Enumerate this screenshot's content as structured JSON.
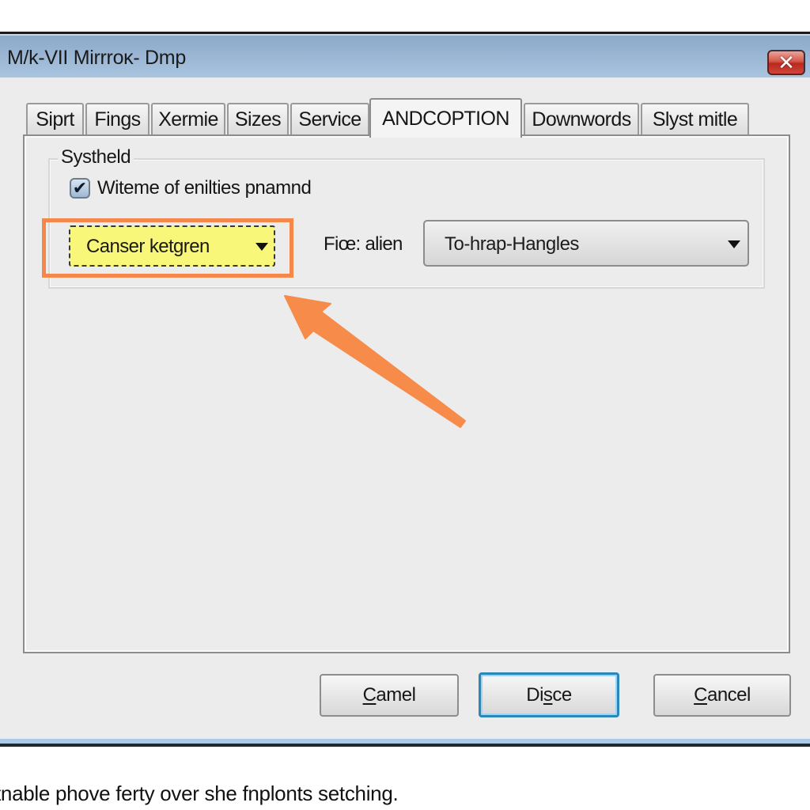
{
  "window": {
    "title": "M/k-VII Mirrroĸ- Dmp",
    "close_icon": "close-x-icon"
  },
  "tabs": [
    {
      "label": "Siprt",
      "active": false
    },
    {
      "label": "Fings",
      "active": false
    },
    {
      "label": "Xermie",
      "active": false
    },
    {
      "label": "Sizes",
      "active": false
    },
    {
      "label": "Service",
      "active": false
    },
    {
      "label": "ANDCOPTION",
      "active": true
    },
    {
      "label": "Downwords",
      "active": false
    },
    {
      "label": "Slyst mitle",
      "active": false
    }
  ],
  "group": {
    "label": "Systheld",
    "checkbox": {
      "label": "Witeme of enilties pnamnd",
      "checked": true
    },
    "highlighted_combo": {
      "value": "Canser ketgren",
      "icon": "dropdown-caret-icon"
    },
    "field_label": "Fiœ: alien",
    "combo": {
      "value": "To-hrap-Hangles",
      "icon": "dropdown-caret-icon"
    }
  },
  "annotation": {
    "color": "#f5874a",
    "arrow_icon": "annotation-arrow-icon"
  },
  "buttons": [
    {
      "label_mnemonic": "C",
      "label_rest": "amel",
      "default": false
    },
    {
      "label_pre": "Di",
      "label_mnemonic": "s",
      "label_rest": "ce",
      "default": true
    },
    {
      "label_mnemonic": "C",
      "label_rest": "ancel",
      "default": false
    }
  ],
  "caption": "tnable phove ferty over she fnplonts setching."
}
